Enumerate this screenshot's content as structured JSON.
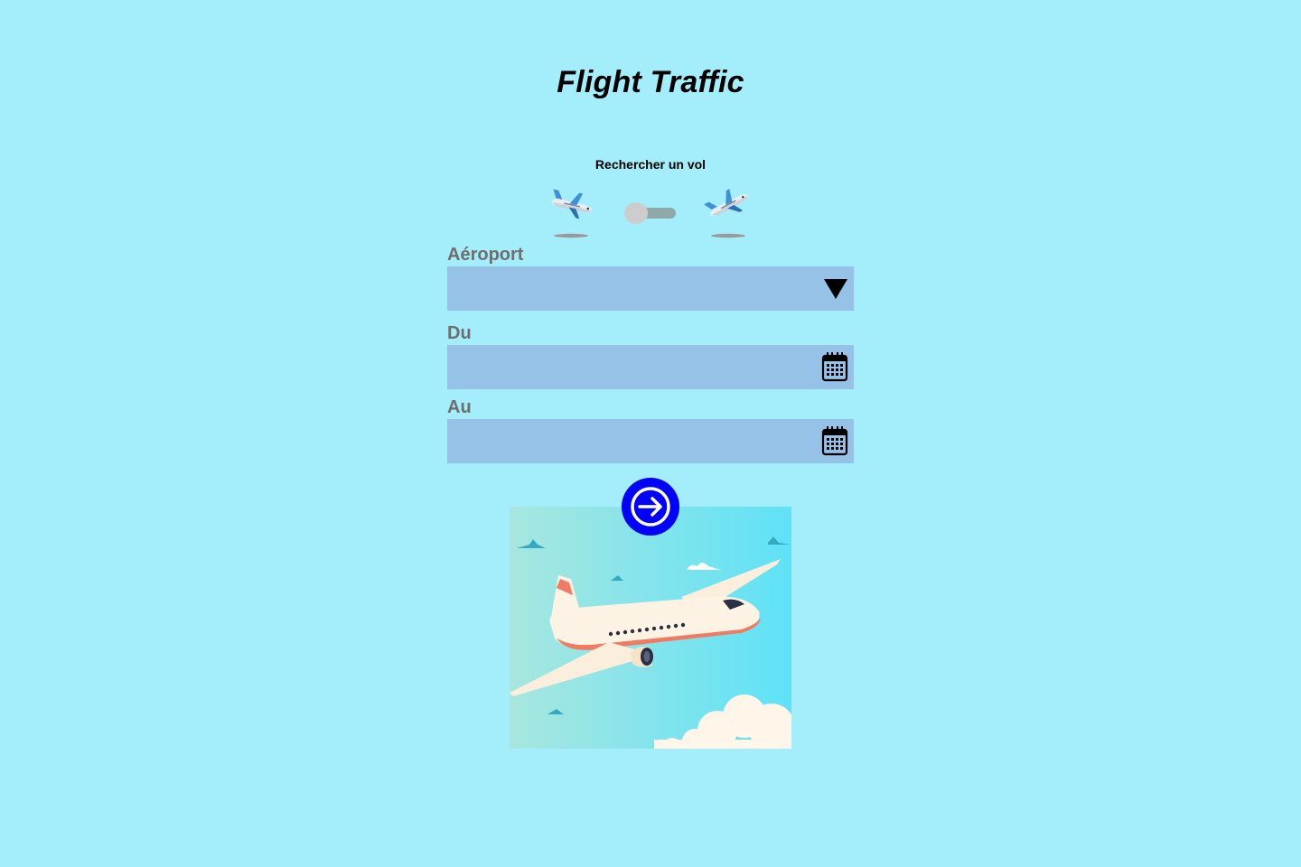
{
  "header": {
    "title": "Flight Traffic"
  },
  "search": {
    "heading": "Rechercher un vol",
    "mode_toggle": {
      "left_icon": "plane-landing-icon",
      "right_icon": "plane-takeoff-icon",
      "state": "off"
    }
  },
  "form": {
    "airport": {
      "label": "Aéroport",
      "value": "",
      "icon": "dropdown-triangle-icon"
    },
    "from": {
      "label": "Du",
      "value": "",
      "icon": "calendar-icon"
    },
    "to": {
      "label": "Au",
      "value": "",
      "icon": "calendar-icon"
    },
    "submit": {
      "icon": "arrow-right-icon"
    }
  },
  "colors": {
    "background": "#a4eefc",
    "field": "#96c2e8",
    "label": "#6e6e6e",
    "submit": "#0000ff"
  }
}
